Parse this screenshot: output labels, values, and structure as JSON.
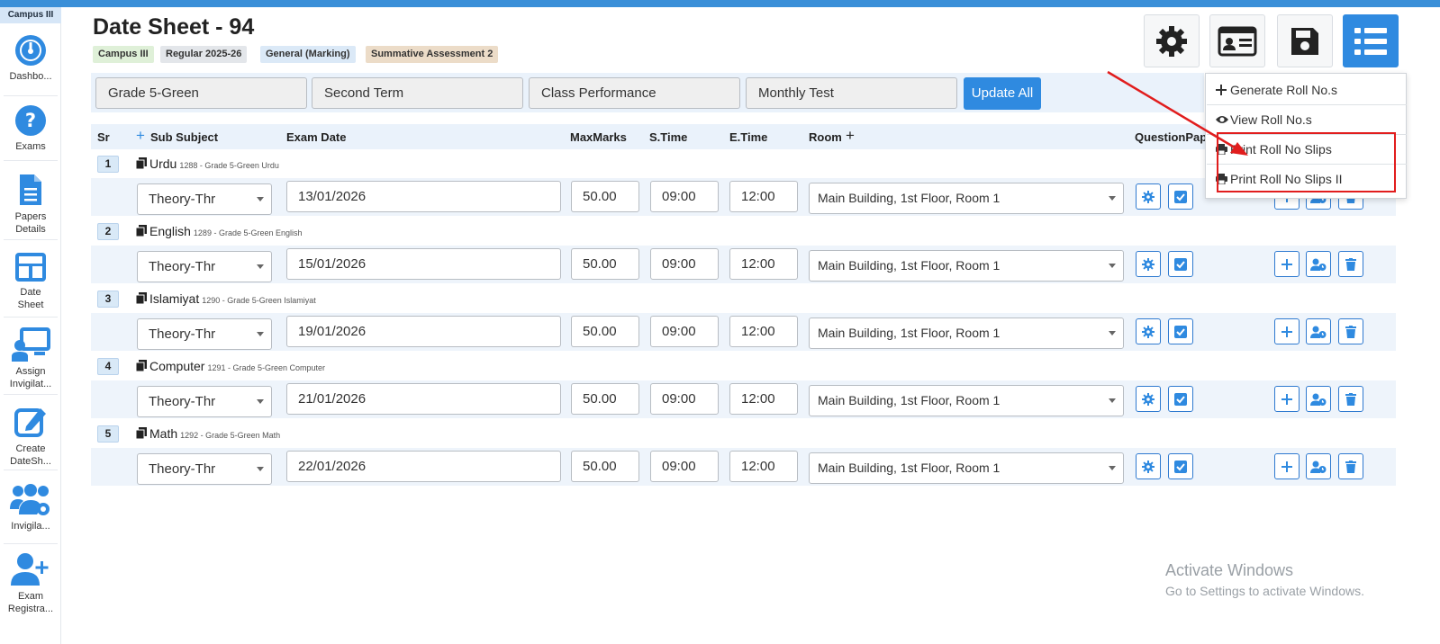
{
  "campus_tag": "Campus III",
  "sidebar": {
    "items": [
      {
        "label": "Dashbo...",
        "icon": "dashboard-icon"
      },
      {
        "label": "Exams",
        "icon": "question-icon"
      },
      {
        "label": "Papers Details",
        "icon": "document-icon"
      },
      {
        "label": "Date Sheet",
        "icon": "grid-icon"
      },
      {
        "label": "Assign Invigilat...",
        "icon": "presenter-icon"
      },
      {
        "label": "Create DateSh...",
        "icon": "edit-icon"
      },
      {
        "label": "Invigila...",
        "icon": "users-gear-icon"
      },
      {
        "label": "Exam Registra...",
        "icon": "user-plus-icon"
      }
    ]
  },
  "page": {
    "title": "Date Sheet - 94",
    "badges": [
      "Campus III",
      "Regular 2025-26",
      "General (Marking)",
      "Summative Assessment 2"
    ]
  },
  "filters": {
    "grade": "Grade 5-Green",
    "term": "Second Term",
    "performance": "Class Performance",
    "test": "Monthly Test",
    "update_label": "Update All"
  },
  "table": {
    "headers": {
      "sr": "Sr",
      "sub_subject": "Sub Subject",
      "exam_date": "Exam Date",
      "max_marks": "MaxMarks",
      "s_time": "S.Time",
      "e_time": "E.Time",
      "room": "Room",
      "question_paper": "QuestionPaper"
    },
    "rows": [
      {
        "sr": "1",
        "subject": "Urdu",
        "meta": "1288 - Grade 5-Green Urdu",
        "type": "Theory-Thr",
        "date": "13/01/2026",
        "marks": "50.00",
        "start": "09:00",
        "end": "12:00",
        "room": "Main Building, 1st Floor, Room 1"
      },
      {
        "sr": "2",
        "subject": "English",
        "meta": "1289 - Grade 5-Green English",
        "type": "Theory-Thr",
        "date": "15/01/2026",
        "marks": "50.00",
        "start": "09:00",
        "end": "12:00",
        "room": "Main Building, 1st Floor, Room 1"
      },
      {
        "sr": "3",
        "subject": "Islamiyat",
        "meta": "1290 - Grade 5-Green Islamiyat",
        "type": "Theory-Thr",
        "date": "19/01/2026",
        "marks": "50.00",
        "start": "09:00",
        "end": "12:00",
        "room": "Main Building, 1st Floor, Room 1"
      },
      {
        "sr": "4",
        "subject": "Computer",
        "meta": "1291 - Grade 5-Green Computer",
        "type": "Theory-Thr",
        "date": "21/01/2026",
        "marks": "50.00",
        "start": "09:00",
        "end": "12:00",
        "room": "Main Building, 1st Floor, Room 1"
      },
      {
        "sr": "5",
        "subject": "Math",
        "meta": "1292 - Grade 5-Green Math",
        "type": "Theory-Thr",
        "date": "22/01/2026",
        "marks": "50.00",
        "start": "09:00",
        "end": "12:00",
        "room": "Main Building, 1st Floor, Room 1"
      }
    ]
  },
  "dropdown": {
    "items": [
      "Generate Roll No.s",
      "View Roll No.s",
      "Print Roll No Slips",
      "Print Roll No Slips II"
    ]
  },
  "watermark": {
    "line1": "Activate Windows",
    "line2": "Go to Settings to activate Windows."
  },
  "colors": {
    "accent": "#2f8ae0",
    "annotation": "#e11d1d"
  }
}
